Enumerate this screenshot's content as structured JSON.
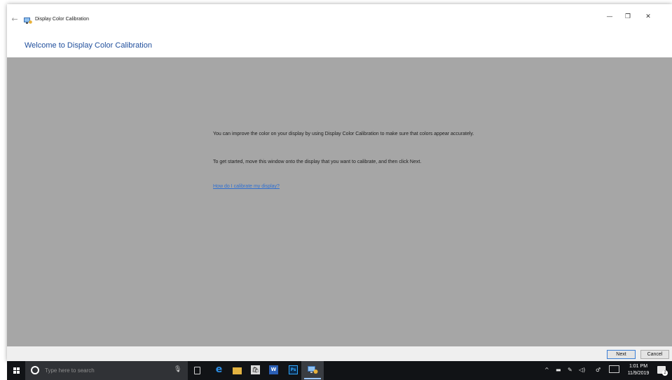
{
  "window": {
    "title": "Display Color Calibration",
    "heading": "Welcome to Display Color Calibration",
    "controls": {
      "minimize": "—",
      "maximize": "❐",
      "close": "✕"
    },
    "back_icon": "←"
  },
  "content": {
    "paragraph_1": "You can improve the color on your display by using Display Color Calibration to make sure that colors appear accurately.",
    "paragraph_2": "To get started, move this window onto the display that you want to calibrate, and then click Next.",
    "help_link": "How do I calibrate my display?"
  },
  "footer": {
    "next_label": "Next",
    "cancel_label": "Cancel"
  },
  "taskbar": {
    "search_placeholder": "Type here to search",
    "mic_icon": "🎙",
    "word_label": "W",
    "ps_label": "Ps",
    "clock": {
      "time": "1:01 PM",
      "date": "11/9/2019"
    },
    "notification_count": "2",
    "icons": [
      "windows-start-icon",
      "cortana-icon",
      "microphone-icon",
      "task-view-icon",
      "edge-icon",
      "file-explorer-icon",
      "store-icon",
      "word-icon",
      "photoshop-icon",
      "display-color-calibration-icon"
    ],
    "tray_icons": [
      "chevron-up-icon",
      "battery-icon",
      "pen-icon",
      "volume-icon",
      "network-icon",
      "keyboard-icon",
      "action-center-icon"
    ]
  },
  "colors": {
    "content_background": "#a6a6a6",
    "heading": "#1f4e9c",
    "link": "#2f6fd1",
    "taskbar": "#111316"
  }
}
